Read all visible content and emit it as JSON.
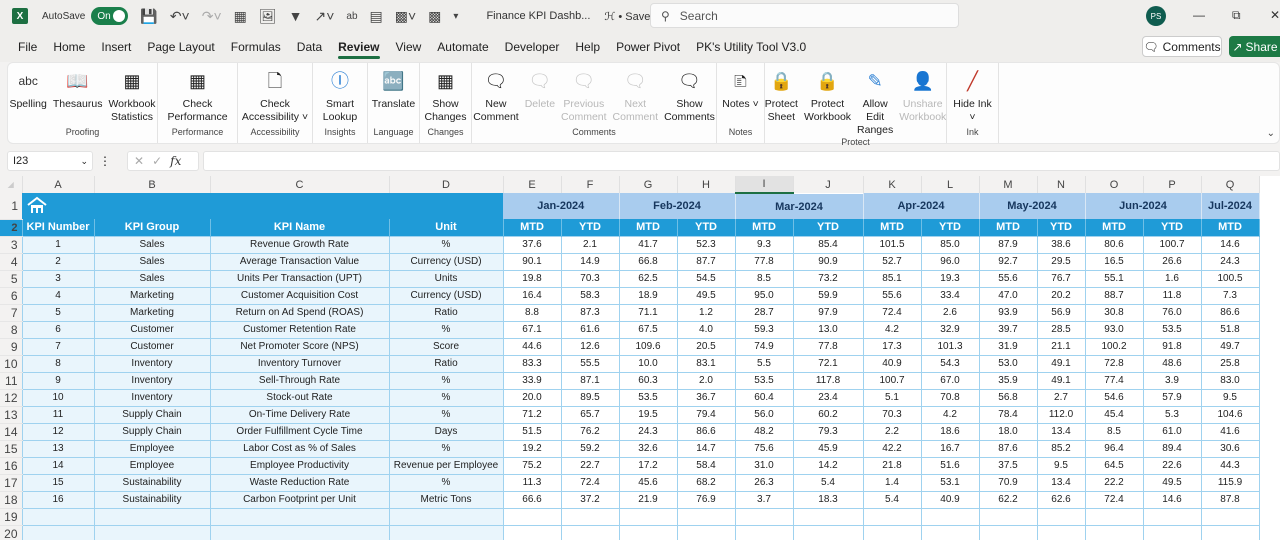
{
  "titlebar": {
    "app_icon": "excel-icon",
    "autosave_label": "AutoSave",
    "autosave_state": "On",
    "document_title": "Finance KPI Dashb...",
    "save_status": "• Saved",
    "search_placeholder": "Search",
    "user_initials": "PS"
  },
  "menu": {
    "tabs": [
      "File",
      "Home",
      "Insert",
      "Page Layout",
      "Formulas",
      "Data",
      "Review",
      "View",
      "Automate",
      "Developer",
      "Help",
      "Power Pivot",
      "PK's Utility Tool V3.0"
    ],
    "active_tab": "Review",
    "comments_label": "Comments",
    "share_label": "Share"
  },
  "ribbon": {
    "groups": [
      {
        "label": "Proofing",
        "buttons": [
          {
            "label": "Spelling",
            "icon": "spelling-icon",
            "enabled": true
          },
          {
            "label": "Thesaurus",
            "icon": "thesaurus-icon",
            "enabled": true
          },
          {
            "label": "Workbook Statistics",
            "icon": "workbook-statistics-icon",
            "enabled": true
          }
        ]
      },
      {
        "label": "Performance",
        "buttons": [
          {
            "label": "Check Performance",
            "icon": "check-performance-icon",
            "enabled": true
          }
        ]
      },
      {
        "label": "Accessibility",
        "buttons": [
          {
            "label": "Check Accessibility ˅",
            "icon": "check-accessibility-icon",
            "enabled": true
          }
        ]
      },
      {
        "label": "Insights",
        "buttons": [
          {
            "label": "Smart Lookup",
            "icon": "smart-lookup-icon",
            "enabled": true
          }
        ]
      },
      {
        "label": "Language",
        "buttons": [
          {
            "label": "Translate",
            "icon": "translate-icon",
            "enabled": true
          }
        ]
      },
      {
        "label": "Changes",
        "buttons": [
          {
            "label": "Show Changes",
            "icon": "show-changes-icon",
            "enabled": true
          }
        ]
      },
      {
        "label": "Comments",
        "buttons": [
          {
            "label": "New Comment",
            "icon": "new-comment-icon",
            "enabled": true
          },
          {
            "label": "Delete",
            "icon": "delete-comment-icon",
            "enabled": false
          },
          {
            "label": "Previous Comment",
            "icon": "previous-comment-icon",
            "enabled": false
          },
          {
            "label": "Next Comment",
            "icon": "next-comment-icon",
            "enabled": false
          },
          {
            "label": "Show Comments",
            "icon": "show-comments-icon",
            "enabled": true
          }
        ]
      },
      {
        "label": "Notes",
        "buttons": [
          {
            "label": "Notes ˅",
            "icon": "notes-icon",
            "enabled": true
          }
        ]
      },
      {
        "label": "Protect",
        "buttons": [
          {
            "label": "Protect Sheet",
            "icon": "protect-sheet-icon",
            "enabled": true
          },
          {
            "label": "Protect Workbook",
            "icon": "protect-workbook-icon",
            "enabled": true
          },
          {
            "label": "Allow Edit Ranges",
            "icon": "allow-edit-ranges-icon",
            "enabled": true
          },
          {
            "label": "Unshare Workbook",
            "icon": "unshare-workbook-icon",
            "enabled": false
          }
        ]
      },
      {
        "label": "Ink",
        "buttons": [
          {
            "label": "Hide Ink ˅",
            "icon": "hide-ink-icon",
            "enabled": true
          }
        ]
      }
    ]
  },
  "formula_bar": {
    "name_box": "I23",
    "formula": ""
  },
  "sheet": {
    "column_letters": [
      "A",
      "B",
      "C",
      "D",
      "E",
      "F",
      "G",
      "H",
      "I",
      "J",
      "K",
      "L",
      "M",
      "N",
      "O",
      "P",
      "Q"
    ],
    "selected_column": "I",
    "row_numbers": [
      1,
      2,
      3,
      4,
      5,
      6,
      7,
      8,
      9,
      10,
      11,
      12,
      13,
      14,
      15,
      16,
      17,
      18,
      19,
      20
    ],
    "months": [
      "Jan-2024",
      "Feb-2024",
      "Mar-2024",
      "Apr-2024",
      "May-2024",
      "Jun-2024",
      "Jul-2024"
    ],
    "headers": [
      "KPI Number",
      "KPI Group",
      "KPI Name",
      "Unit"
    ],
    "sub_headers": [
      "MTD",
      "YTD",
      "MTD",
      "YTD",
      "MTD",
      "YTD",
      "MTD",
      "YTD",
      "MTD",
      "YTD",
      "MTD",
      "YTD",
      "MTD"
    ],
    "rows": [
      {
        "num": "1",
        "group": "Sales",
        "name": "Revenue Growth Rate",
        "unit": "%",
        "values": [
          "37.6",
          "2.1",
          "41.7",
          "52.3",
          "9.3",
          "85.4",
          "101.5",
          "85.0",
          "87.9",
          "38.6",
          "80.6",
          "100.7",
          "14.6"
        ]
      },
      {
        "num": "2",
        "group": "Sales",
        "name": "Average Transaction Value",
        "unit": "Currency (USD)",
        "values": [
          "90.1",
          "14.9",
          "66.8",
          "87.7",
          "77.8",
          "90.9",
          "52.7",
          "96.0",
          "92.7",
          "29.5",
          "16.5",
          "26.6",
          "24.3"
        ]
      },
      {
        "num": "3",
        "group": "Sales",
        "name": "Units Per Transaction (UPT)",
        "unit": "Units",
        "values": [
          "19.8",
          "70.3",
          "62.5",
          "54.5",
          "8.5",
          "73.2",
          "85.1",
          "19.3",
          "55.6",
          "76.7",
          "55.1",
          "1.6",
          "100.5"
        ]
      },
      {
        "num": "4",
        "group": "Marketing",
        "name": "Customer Acquisition Cost",
        "unit": "Currency (USD)",
        "values": [
          "16.4",
          "58.3",
          "18.9",
          "49.5",
          "95.0",
          "59.9",
          "55.6",
          "33.4",
          "47.0",
          "20.2",
          "88.7",
          "11.8",
          "7.3"
        ]
      },
      {
        "num": "5",
        "group": "Marketing",
        "name": "Return on Ad Spend (ROAS)",
        "unit": "Ratio",
        "values": [
          "8.8",
          "87.3",
          "71.1",
          "1.2",
          "28.7",
          "97.9",
          "72.4",
          "2.6",
          "93.9",
          "56.9",
          "30.8",
          "76.0",
          "86.6"
        ]
      },
      {
        "num": "6",
        "group": "Customer",
        "name": "Customer Retention Rate",
        "unit": "%",
        "values": [
          "67.1",
          "61.6",
          "67.5",
          "4.0",
          "59.3",
          "13.0",
          "4.2",
          "32.9",
          "39.7",
          "28.5",
          "93.0",
          "53.5",
          "51.8"
        ]
      },
      {
        "num": "7",
        "group": "Customer",
        "name": "Net Promoter Score (NPS)",
        "unit": "Score",
        "values": [
          "44.6",
          "12.6",
          "109.6",
          "20.5",
          "74.9",
          "77.8",
          "17.3",
          "101.3",
          "31.9",
          "21.1",
          "100.2",
          "91.8",
          "49.7"
        ]
      },
      {
        "num": "8",
        "group": "Inventory",
        "name": "Inventory Turnover",
        "unit": "Ratio",
        "values": [
          "83.3",
          "55.5",
          "10.0",
          "83.1",
          "5.5",
          "72.1",
          "40.9",
          "54.3",
          "53.0",
          "49.1",
          "72.8",
          "48.6",
          "25.8"
        ]
      },
      {
        "num": "9",
        "group": "Inventory",
        "name": "Sell-Through Rate",
        "unit": "%",
        "values": [
          "33.9",
          "87.1",
          "60.3",
          "2.0",
          "53.5",
          "117.8",
          "100.7",
          "67.0",
          "35.9",
          "49.1",
          "77.4",
          "3.9",
          "83.0"
        ]
      },
      {
        "num": "10",
        "group": "Inventory",
        "name": "Stock-out Rate",
        "unit": "%",
        "values": [
          "20.0",
          "89.5",
          "53.5",
          "36.7",
          "60.4",
          "23.4",
          "5.1",
          "70.8",
          "56.8",
          "2.7",
          "54.6",
          "57.9",
          "9.5"
        ]
      },
      {
        "num": "11",
        "group": "Supply Chain",
        "name": "On-Time Delivery Rate",
        "unit": "%",
        "values": [
          "71.2",
          "65.7",
          "19.5",
          "79.4",
          "56.0",
          "60.2",
          "70.3",
          "4.2",
          "78.4",
          "112.0",
          "45.4",
          "5.3",
          "104.6"
        ]
      },
      {
        "num": "12",
        "group": "Supply Chain",
        "name": "Order Fulfillment Cycle Time",
        "unit": "Days",
        "values": [
          "51.5",
          "76.2",
          "24.3",
          "86.6",
          "48.2",
          "79.3",
          "2.2",
          "18.6",
          "18.0",
          "13.4",
          "8.5",
          "61.0",
          "41.6"
        ]
      },
      {
        "num": "13",
        "group": "Employee",
        "name": "Labor Cost as % of Sales",
        "unit": "%",
        "values": [
          "19.2",
          "59.2",
          "32.6",
          "14.7",
          "75.6",
          "45.9",
          "42.2",
          "16.7",
          "87.6",
          "85.2",
          "96.4",
          "89.4",
          "30.6"
        ]
      },
      {
        "num": "14",
        "group": "Employee",
        "name": "Employee Productivity",
        "unit": "Revenue per Employee",
        "values": [
          "75.2",
          "22.7",
          "17.2",
          "58.4",
          "31.0",
          "14.2",
          "21.8",
          "51.6",
          "37.5",
          "9.5",
          "64.5",
          "22.6",
          "44.3"
        ]
      },
      {
        "num": "15",
        "group": "Sustainability",
        "name": "Waste Reduction Rate",
        "unit": "%",
        "values": [
          "11.3",
          "72.4",
          "45.6",
          "68.2",
          "26.3",
          "5.4",
          "1.4",
          "53.1",
          "70.9",
          "13.4",
          "22.2",
          "49.5",
          "115.9"
        ]
      },
      {
        "num": "16",
        "group": "Sustainability",
        "name": "Carbon Footprint per Unit",
        "unit": "Metric Tons",
        "values": [
          "66.6",
          "37.2",
          "21.9",
          "76.9",
          "3.7",
          "18.3",
          "5.4",
          "40.9",
          "62.2",
          "62.6",
          "72.4",
          "14.6",
          "87.8"
        ]
      }
    ],
    "empty_rows": 2
  },
  "colors": {
    "header_blue": "#1f9bd7",
    "month_band": "#a9ccee",
    "excel_green": "#1d6f42"
  }
}
